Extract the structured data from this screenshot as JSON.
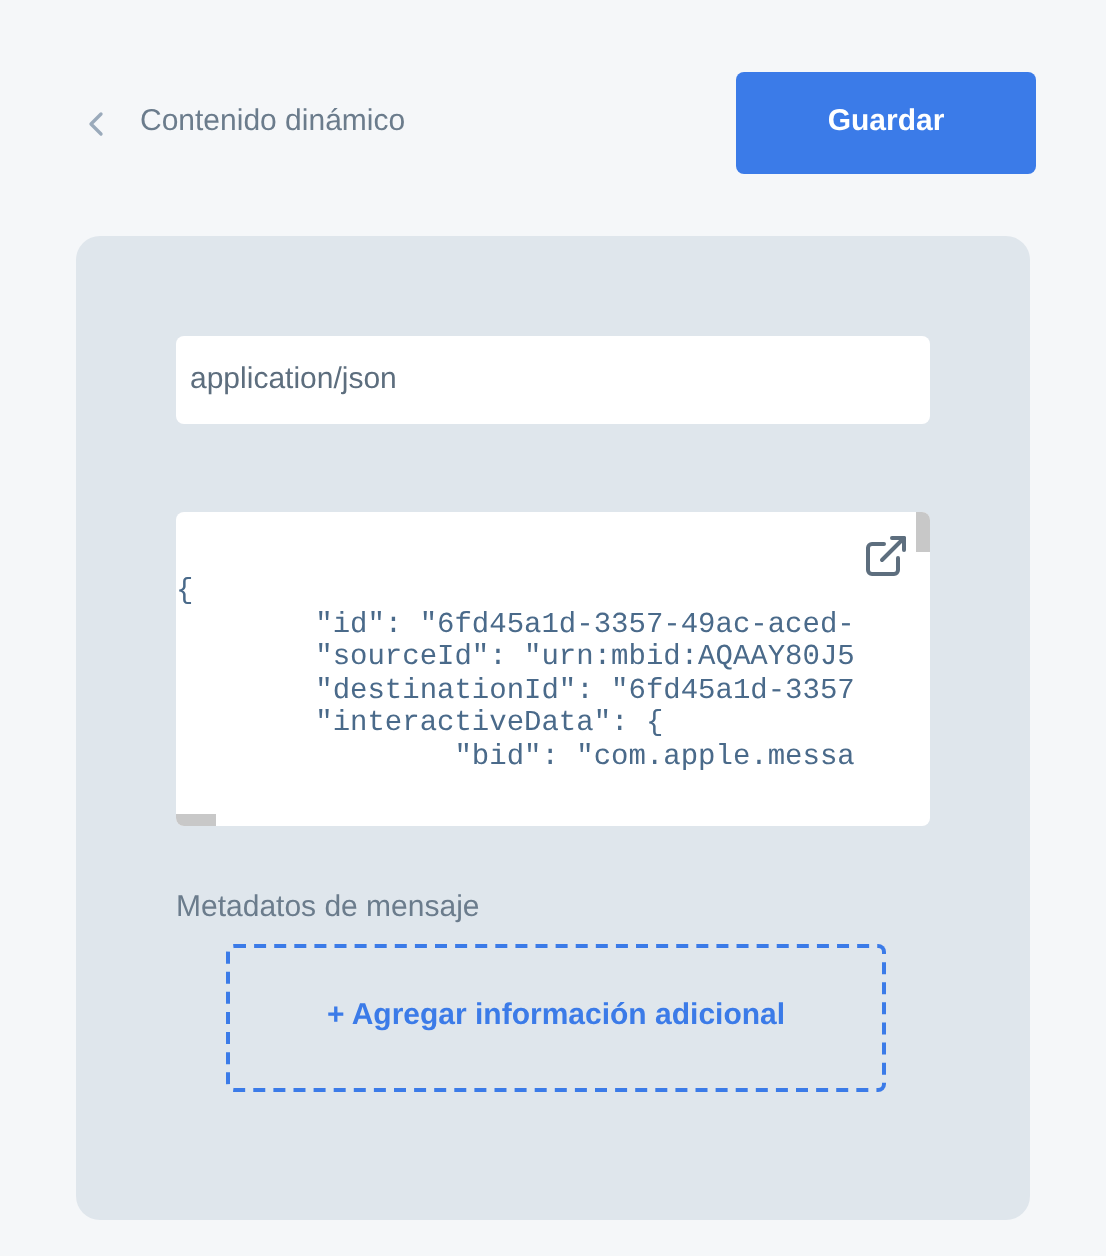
{
  "header": {
    "back_label": "Contenido dinámico",
    "save_button": "Guardar"
  },
  "content_type": {
    "value": "application/json"
  },
  "code_editor": {
    "lines": [
      "{",
      "        \"id\": \"6fd45a1d-3357-49ac-aced-",
      "        \"sourceId\": \"urn:mbid:AQAAY80J5",
      "        \"destinationId\": \"6fd45a1d-3357",
      "        \"interactiveData\": {",
      "                \"bid\": \"com.apple.messa"
    ]
  },
  "metadata": {
    "label": "Metadatos de mensaje",
    "add_button": "+ Agregar información adicional"
  }
}
